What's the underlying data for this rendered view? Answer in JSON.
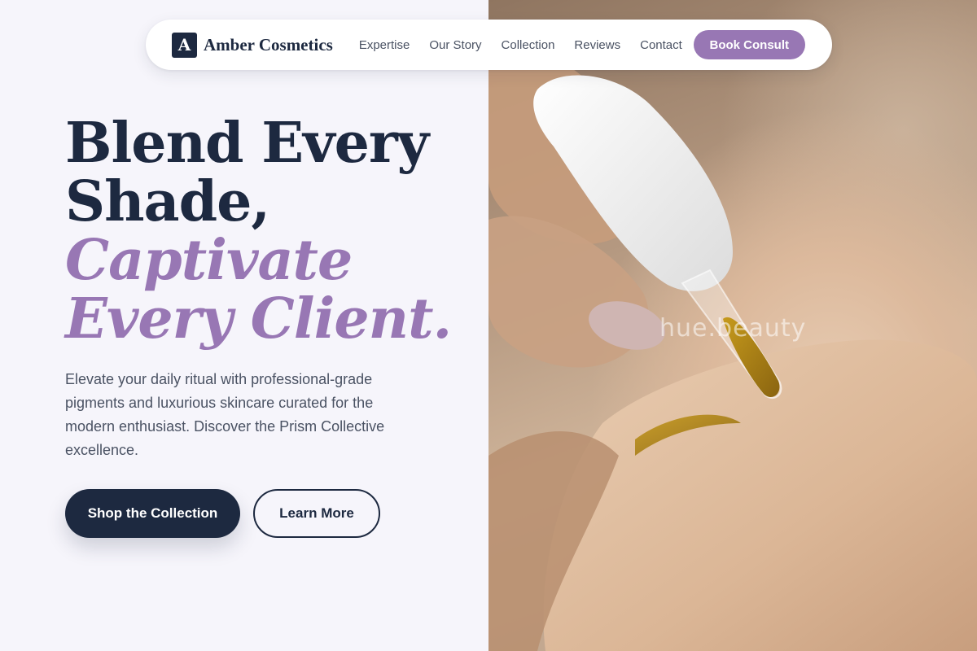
{
  "brand": {
    "mark": "A",
    "name": "Amber Cosmetics"
  },
  "nav": {
    "links": [
      "Expertise",
      "Our Story",
      "Collection",
      "Reviews",
      "Contact"
    ],
    "cta": "Book Consult"
  },
  "hero": {
    "headline_lines": [
      "Blend Every",
      "Shade,"
    ],
    "accent_lines": [
      "Captivate",
      "Every Client."
    ],
    "subtitle": "Elevate your daily ritual with professional-grade pigments and luxurious skincare curated for the modern enthusiast. Discover the Prism Collective excellence.",
    "primary_button": "Shop the Collection",
    "secondary_button": "Learn More",
    "image_watermark": "hue.beauty"
  },
  "colors": {
    "navy": "#1d2940",
    "lavender": "#9877b4",
    "background": "#f6f5fb"
  }
}
